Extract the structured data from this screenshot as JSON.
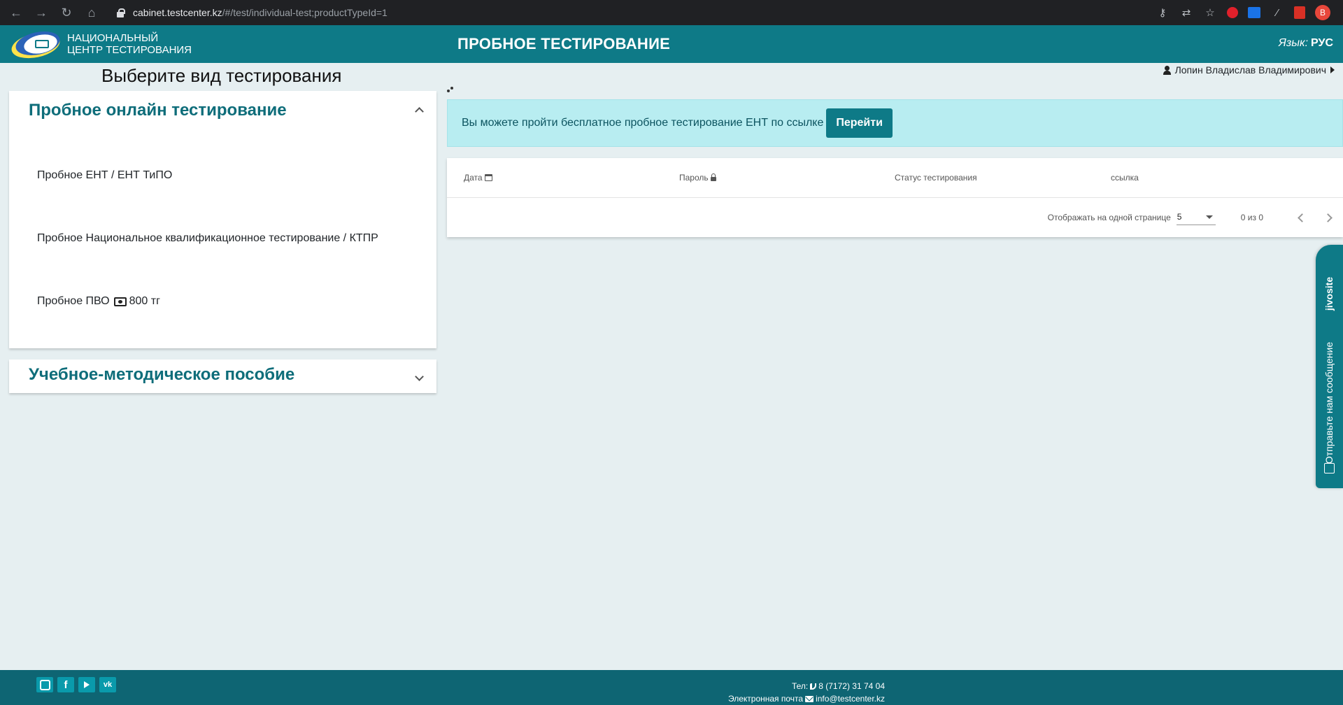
{
  "browser": {
    "url_host": "cabinet.testcenter.kz",
    "url_path": "/#/test/individual-test;productTypeId=1",
    "profile_initial": "B"
  },
  "header": {
    "logo_line1": "НАЦИОНАЛЬНЫЙ",
    "logo_line2": "ЦЕНТР ТЕСТИРОВАНИЯ",
    "title": "ПРОБНОЕ ТЕСТИРОВАНИЕ",
    "language_label": "Язык:",
    "language_value": "РУС"
  },
  "main": {
    "choose_title": "Выберите вид тестирования",
    "user_name": "Лопин Владислав Владимирович",
    "panels": [
      {
        "title": "Пробное онлайн тестирование",
        "expanded": true,
        "items": [
          {
            "label": "Пробное ЕНТ / ЕНТ ТиПО"
          },
          {
            "label": "Пробное Национальное квалификационное тестирование / КТПР"
          },
          {
            "label": "Пробное ПВО",
            "price": "800 тг"
          }
        ]
      },
      {
        "title": "Учебное-методическое пособие",
        "expanded": false
      }
    ],
    "alert": {
      "text": "Вы можете пройти бесплатное пробное тестирование ЕНТ по ссылке",
      "button": "Перейти"
    },
    "table": {
      "columns": [
        "Дата",
        "Пароль",
        "Статус тестирования",
        "ссылка"
      ],
      "rows": [],
      "paginator": {
        "page_size_label": "Отображать на одной странице",
        "page_size": "5",
        "range": "0 из 0"
      }
    }
  },
  "chat_widget": {
    "brand": "jivosite",
    "message": "Отправьте нам сообщение"
  },
  "footer": {
    "phone_label": "Тел:",
    "phone": "8 (7172) 31 74 04",
    "email_label": "Электронная почта",
    "email": "info@testcenter.kz",
    "socials": [
      "instagram-icon",
      "facebook-icon",
      "youtube-icon",
      "vk-icon"
    ]
  },
  "colors": {
    "primary": "#0e7a87",
    "footer": "#0e6573",
    "background": "#e6eff1",
    "alert_bg": "#b8edf1"
  }
}
